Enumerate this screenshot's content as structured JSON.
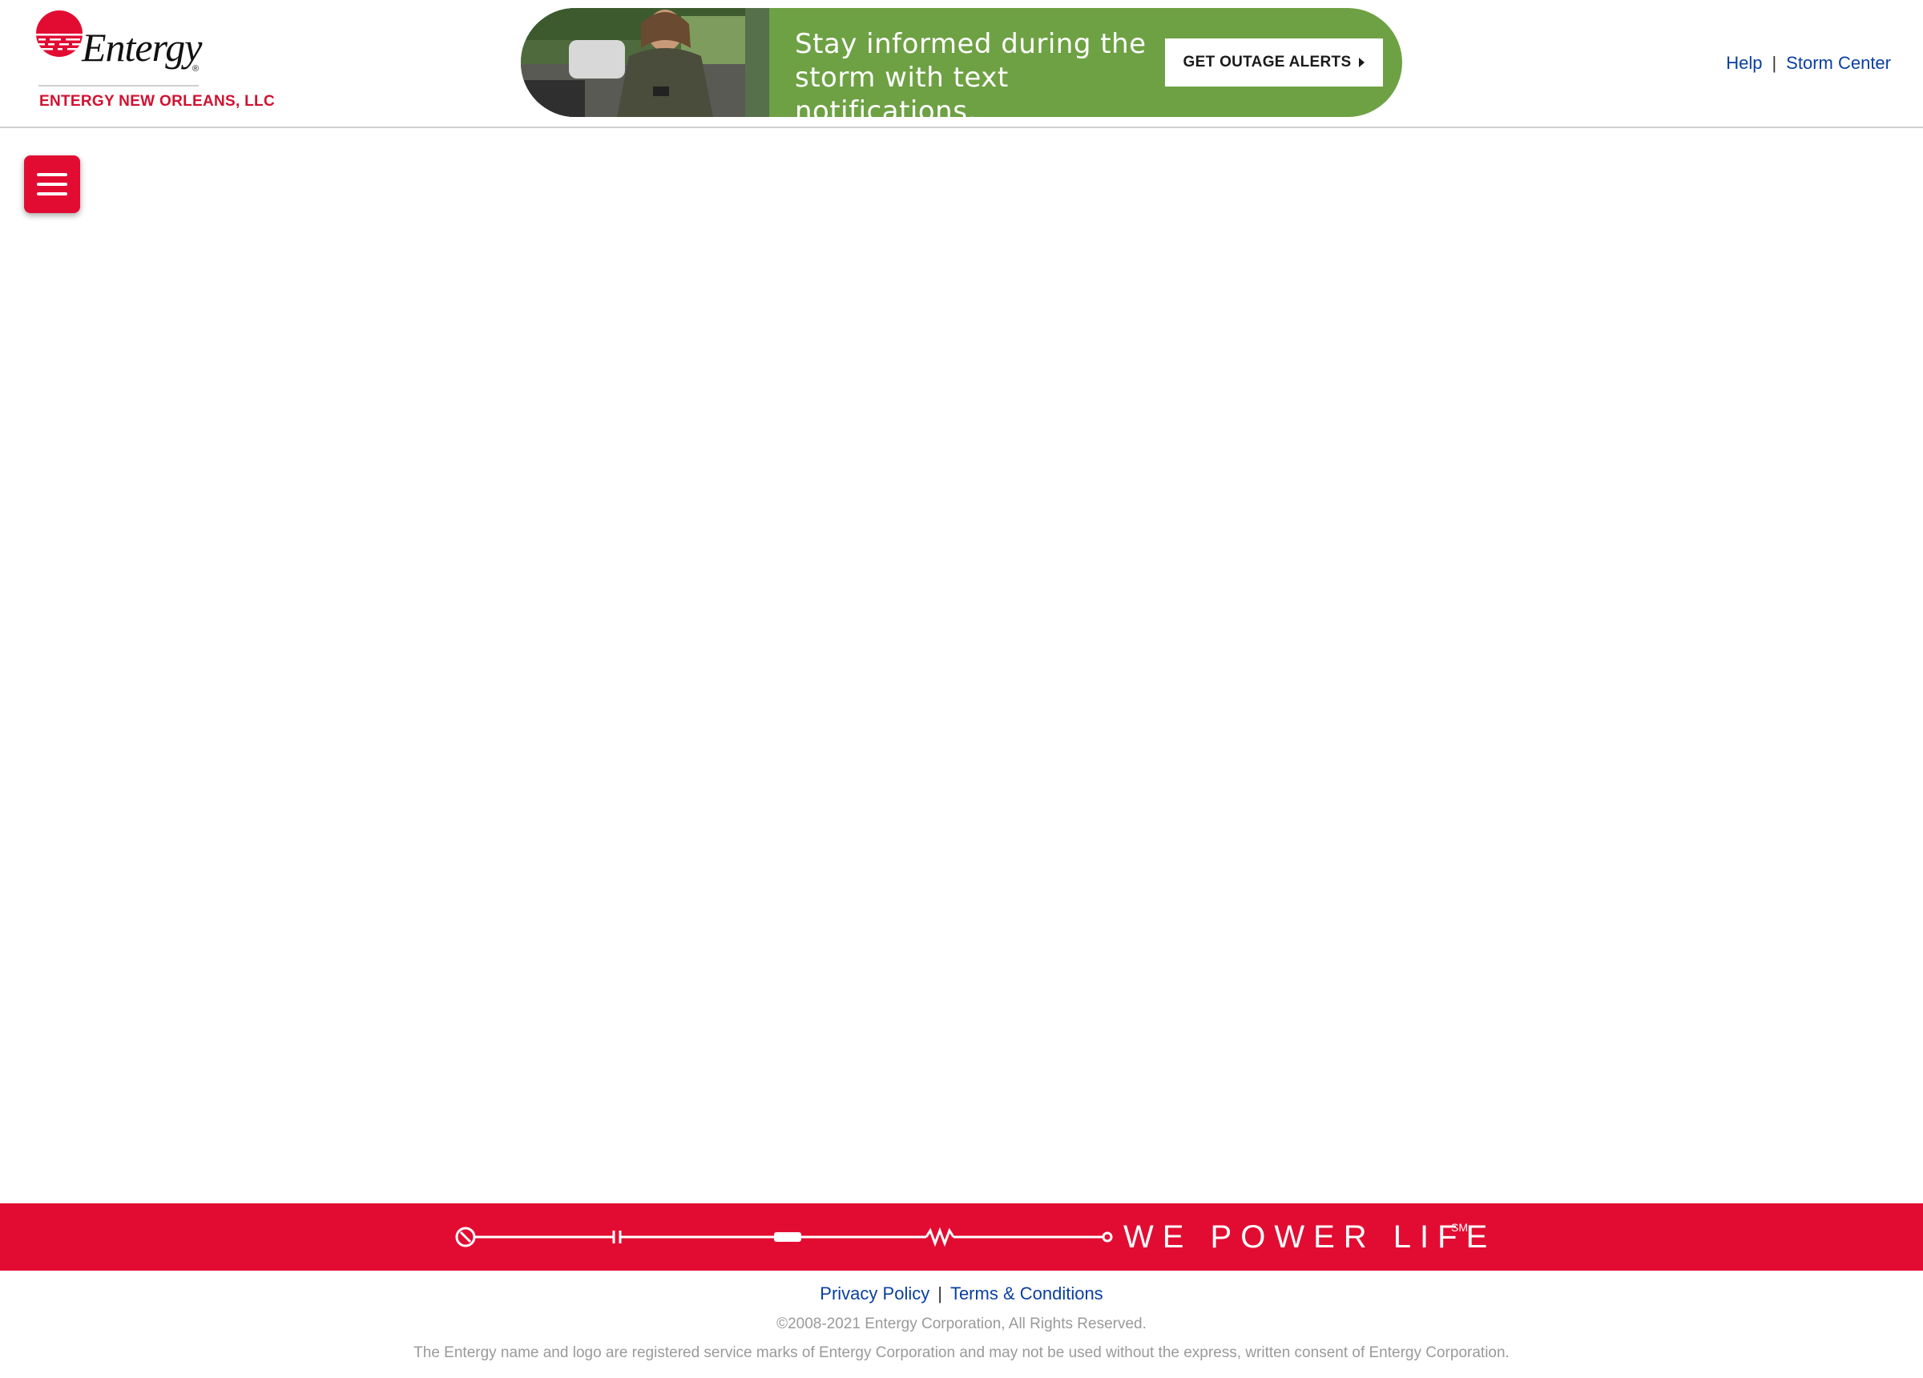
{
  "header": {
    "logo_text": "Entergy",
    "logo_reg": "®",
    "company": "ENTERGY NEW ORLEANS, LLC",
    "banner": {
      "line1": "Stay informed during the",
      "line2": "storm with text notifications.",
      "button_label": "GET OUTAGE ALERTS"
    },
    "links": {
      "help": "Help",
      "separator": "|",
      "storm_center": "Storm Center"
    }
  },
  "menu_button_icon": "hamburger-menu-icon",
  "footer": {
    "tagline": "WE POWER LIFE",
    "tagline_mark": "SM",
    "links": {
      "privacy": "Privacy Policy",
      "separator": "|",
      "terms": "Terms & Conditions"
    },
    "copyright": "©2008-2021 Entergy Corporation, All Rights Reserved.",
    "disclaimer": "The Entergy name and logo are registered service marks of Entergy Corporation and may not be used without the express, written consent of Entergy Corporation."
  },
  "colors": {
    "brand_red": "#e20c32",
    "link_blue": "#0a40a0",
    "banner_green": "#6ea144"
  }
}
